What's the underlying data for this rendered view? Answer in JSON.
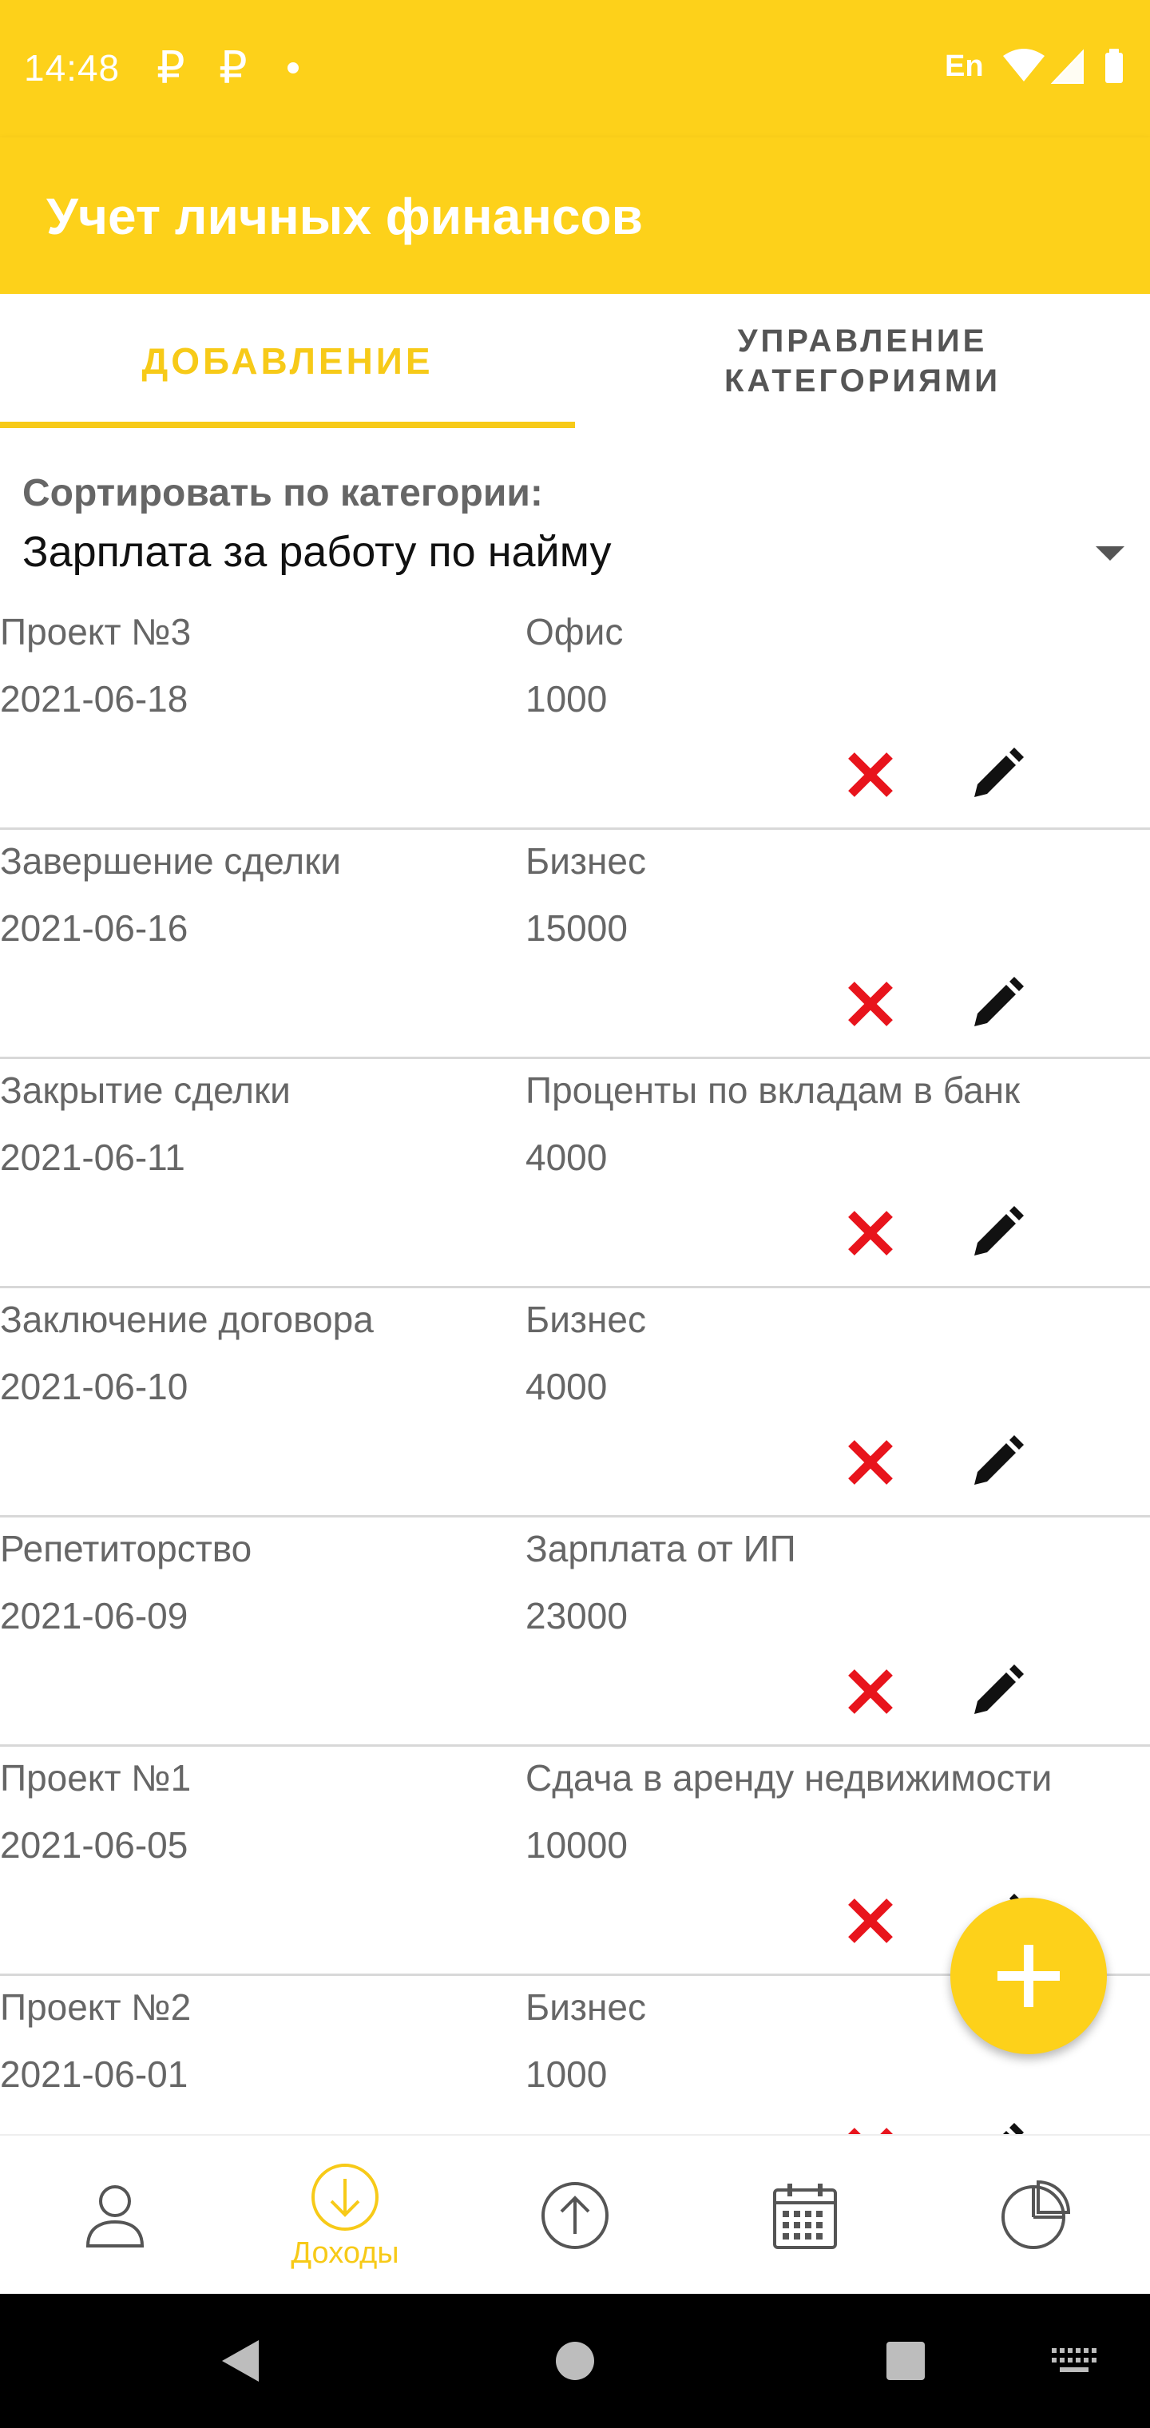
{
  "status_bar": {
    "time": "14:48",
    "notif_icons": [
      "₽",
      "₽"
    ],
    "language": "En"
  },
  "app_bar": {
    "title": "Учет личных финансов"
  },
  "tabs": [
    {
      "label": "ДОБАВЛЕНИЕ",
      "active": true
    },
    {
      "label_line1": "УПРАВЛЕНИЕ",
      "label_line2": "КАТЕГОРИЯМИ",
      "active": false
    }
  ],
  "sort": {
    "label": "Сортировать по категории:",
    "selected": "Зарплата за работу по найму"
  },
  "entries": [
    {
      "name": "Проект №3",
      "date": "2021-06-18",
      "category": "Офис",
      "amount": "1000"
    },
    {
      "name": "Завершение сделки",
      "date": "2021-06-16",
      "category": "Бизнес",
      "amount": "15000"
    },
    {
      "name": "Закрытие сделки",
      "date": "2021-06-11",
      "category": "Проценты по вкладам в банк",
      "amount": "4000"
    },
    {
      "name": "Заключение договора",
      "date": "2021-06-10",
      "category": "Бизнес",
      "amount": "4000"
    },
    {
      "name": "Репетиторство",
      "date": "2021-06-09",
      "category": "Зарплата от ИП",
      "amount": "23000"
    },
    {
      "name": "Проект №1",
      "date": "2021-06-05",
      "category": "Сдача в аренду недвижимости",
      "amount": "10000"
    },
    {
      "name": "Проект №2",
      "date": "2021-06-01",
      "category": "Бизнес",
      "amount": "1000"
    }
  ],
  "bottom_nav": [
    {
      "icon": "profile-icon",
      "label": ""
    },
    {
      "icon": "income-icon",
      "label": "Доходы",
      "active": true
    },
    {
      "icon": "expense-icon",
      "label": ""
    },
    {
      "icon": "calendar-icon",
      "label": ""
    },
    {
      "icon": "pie-chart-icon",
      "label": ""
    }
  ],
  "colors": {
    "accent": "#FDD11A",
    "accent_text": "#F7CA18",
    "delete": "#E8141C",
    "text_secondary": "#666666"
  }
}
